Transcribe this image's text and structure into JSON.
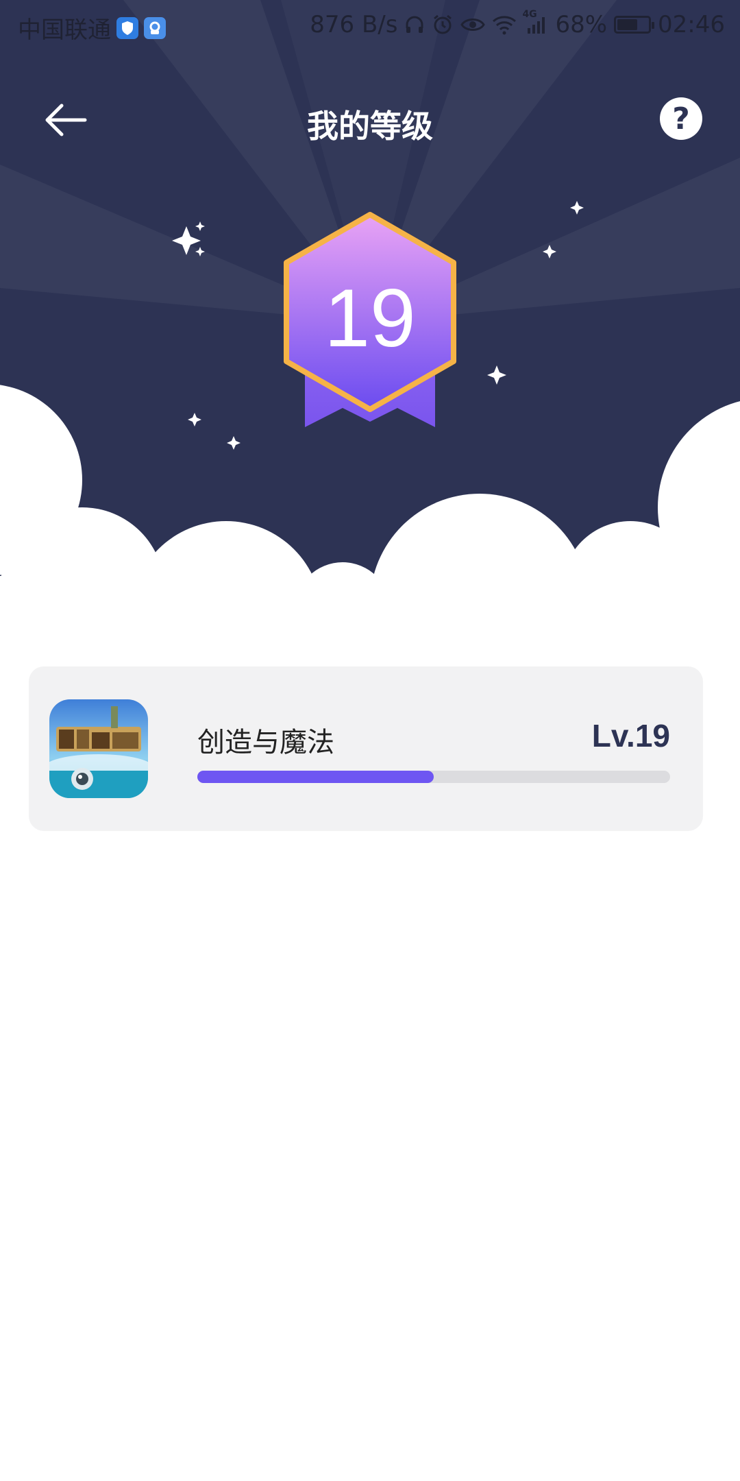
{
  "status_bar": {
    "carrier": "中国联通",
    "net_speed": "876 B/s",
    "network": "4G",
    "battery": "68%",
    "battery_fraction": 0.68,
    "time": "02:46"
  },
  "header": {
    "title": "我的等级",
    "help_label": "?"
  },
  "badge": {
    "level": "19"
  },
  "games": [
    {
      "name": "创造与魔法",
      "level_label": "Lv.19",
      "progress_fraction": 0.5
    }
  ],
  "colors": {
    "hero_bg": "#2d3354",
    "accent": "#6e56f2",
    "badge_gold": "#f6b347"
  },
  "icons": [
    "back-arrow-icon",
    "help-icon",
    "level-badge-icon",
    "sparkle-icon",
    "game-app-icon"
  ]
}
